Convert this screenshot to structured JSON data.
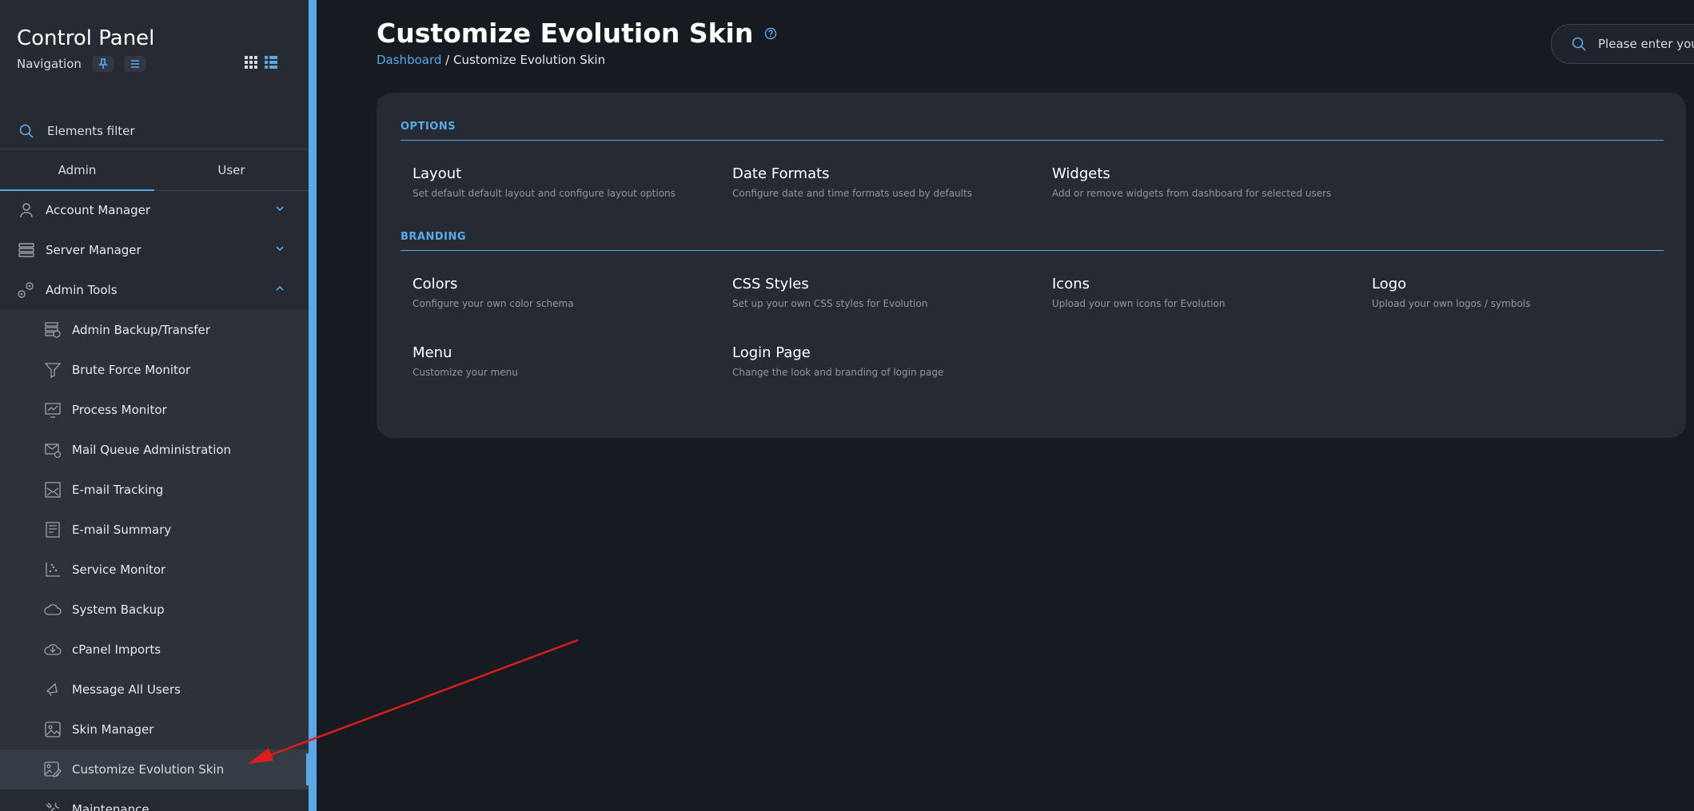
{
  "sidebar": {
    "title": "Control Panel",
    "navigation_label": "Navigation",
    "filter_placeholder": "Elements filter",
    "tabs": [
      {
        "label": "Admin",
        "active": true
      },
      {
        "label": "User",
        "active": false
      }
    ],
    "groups": [
      {
        "label": "Account Manager",
        "icon": "user-icon",
        "expanded": false
      },
      {
        "label": "Server Manager",
        "icon": "server-icon",
        "expanded": false
      },
      {
        "label": "Admin Tools",
        "icon": "gears-icon",
        "expanded": true
      }
    ],
    "admin_tools": [
      {
        "label": "Admin Backup/Transfer",
        "icon": "backup-icon"
      },
      {
        "label": "Brute Force Monitor",
        "icon": "filter-icon"
      },
      {
        "label": "Process Monitor",
        "icon": "monitor-icon"
      },
      {
        "label": "Mail Queue Administration",
        "icon": "mail-queue-icon"
      },
      {
        "label": "E-mail Tracking",
        "icon": "mail-tracking-icon"
      },
      {
        "label": "E-mail Summary",
        "icon": "mail-summary-icon"
      },
      {
        "label": "Service Monitor",
        "icon": "scatter-icon"
      },
      {
        "label": "System Backup",
        "icon": "cloud-icon"
      },
      {
        "label": "cPanel Imports",
        "icon": "cloud-download-icon"
      },
      {
        "label": "Message All Users",
        "icon": "megaphone-icon"
      },
      {
        "label": "Skin Manager",
        "icon": "image-icon"
      },
      {
        "label": "Customize Evolution Skin",
        "icon": "image-edit-icon",
        "active": true
      }
    ],
    "after_group": {
      "label": "Maintenance",
      "icon": "tools-icon"
    }
  },
  "header": {
    "title": "Customize Evolution Skin",
    "breadcrumb_home": "Dashboard",
    "breadcrumb_separator": " / ",
    "breadcrumb_current": "Customize Evolution Skin",
    "search_placeholder": "Please enter your"
  },
  "sections": {
    "options": {
      "heading": "OPTIONS",
      "items": [
        {
          "title": "Layout",
          "desc": "Set default default layout and configure layout options"
        },
        {
          "title": "Date Formats",
          "desc": "Configure date and time formats used by defaults"
        },
        {
          "title": "Widgets",
          "desc": "Add or remove widgets from dashboard for selected users"
        }
      ]
    },
    "branding": {
      "heading": "BRANDING",
      "items": [
        {
          "title": "Colors",
          "desc": "Configure your own color schema"
        },
        {
          "title": "CSS Styles",
          "desc": "Set up your own CSS styles for Evolution"
        },
        {
          "title": "Icons",
          "desc": "Upload your own icons for Evolution"
        },
        {
          "title": "Logo",
          "desc": "Upload your own logos / symbols"
        },
        {
          "title": "Menu",
          "desc": "Customize your menu"
        },
        {
          "title": "Login Page",
          "desc": "Change the look and branding of login page"
        }
      ]
    }
  },
  "colors": {
    "accent": "#5aa9e6",
    "sidebar_bg": "#262b33",
    "main_bg": "#161b22",
    "annotation_arrow": "#e01b1b"
  }
}
